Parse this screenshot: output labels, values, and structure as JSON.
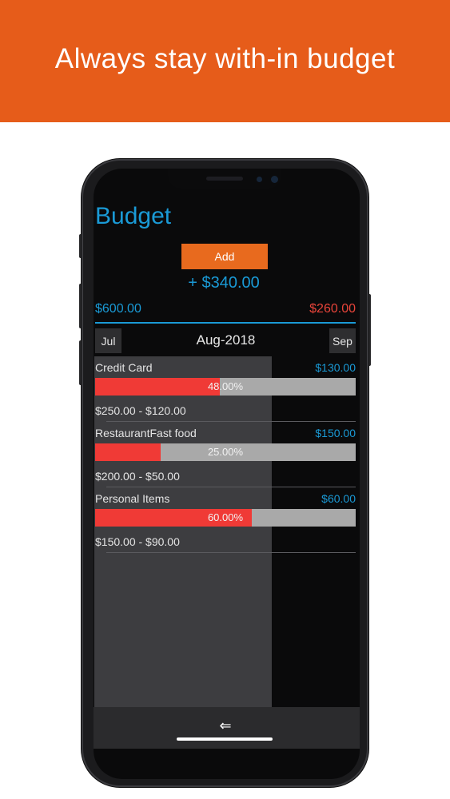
{
  "banner": {
    "text": "Always stay with-in budget"
  },
  "colors": {
    "banner": "#e65c1a",
    "accent_blue": "#1a9ad6",
    "accent_red": "#f03a36",
    "add_button": "#e86a1e"
  },
  "app": {
    "title": "Budget",
    "add_label": "Add",
    "balance": "+ $340.00",
    "total_budget": "$600.00",
    "total_spent": "$260.00"
  },
  "month_nav": {
    "prev": "Jul",
    "current": "Aug-2018",
    "next": "Sep"
  },
  "categories": [
    {
      "name": "Credit Card",
      "amount": "$130.00",
      "percent_label": "48.00%",
      "percent": 0.48,
      "range": "$250.00 - $120.00"
    },
    {
      "name": "RestaurantFast food",
      "amount": "$150.00",
      "percent_label": "25.00%",
      "percent": 0.25,
      "range": "$200.00 - $50.00"
    },
    {
      "name": "Personal Items",
      "amount": "$60.00",
      "percent_label": "60.00%",
      "percent": 0.6,
      "range": "$150.00 - $90.00"
    }
  ],
  "nav": {
    "back_icon": "back-arrow-icon"
  }
}
